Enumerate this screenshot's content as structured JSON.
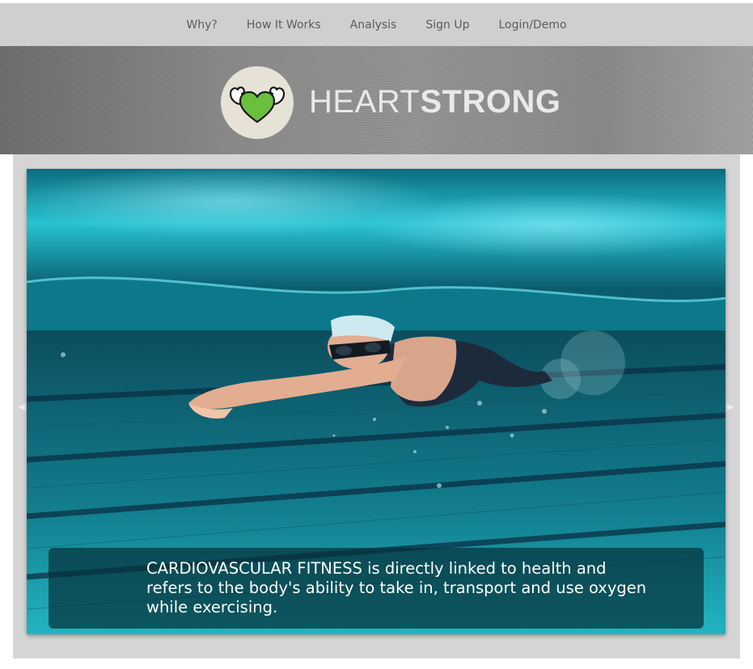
{
  "nav": {
    "items": [
      {
        "label": "Why?"
      },
      {
        "label": "How It Works"
      },
      {
        "label": "Analysis"
      },
      {
        "label": "Sign Up"
      },
      {
        "label": "Login/Demo"
      }
    ]
  },
  "header": {
    "brand_light": "HEART",
    "brand_bold": "STRONG",
    "logo_icon": "muscle-heart-icon",
    "heart_color": "#6abf3d"
  },
  "hero": {
    "image": "underwater-swimmer-photo",
    "caption": "CARDIOVASCULAR FITNESS is directly linked to health and refers to the body's ability to take in, transport and use oxygen while exercising."
  },
  "slider": {
    "prev_icon": "chevron-left-icon",
    "next_icon": "chevron-right-icon"
  }
}
